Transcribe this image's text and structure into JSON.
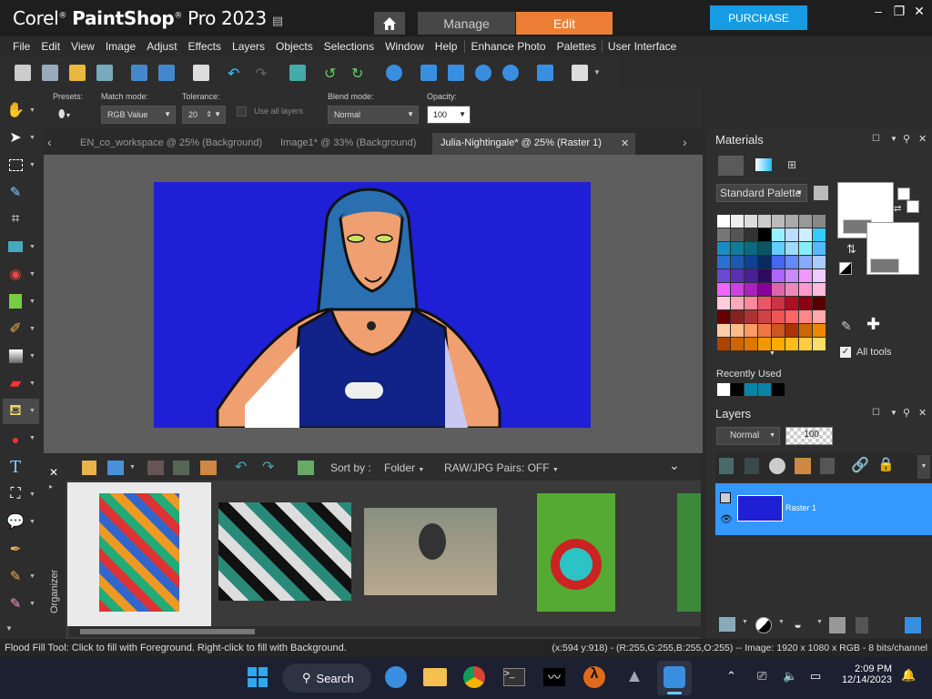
{
  "app": {
    "brand": "Corel",
    "product": "PaintShop",
    "version": "Pro 2023"
  },
  "workspace_tabs": {
    "manage": "Manage",
    "edit": "Edit"
  },
  "purchase": "PURCHASE",
  "menu": [
    "File",
    "Edit",
    "View",
    "Image",
    "Adjust",
    "Effects",
    "Layers",
    "Objects",
    "Selections",
    "Window",
    "Help",
    "Enhance Photo",
    "Palettes",
    "User Interface"
  ],
  "options": {
    "presets_label": "Presets:",
    "match_mode_label": "Match mode:",
    "match_mode_value": "RGB Value",
    "tolerance_label": "Tolerance:",
    "tolerance_value": "20",
    "use_all_layers": "Use all layers",
    "blend_mode_label": "Blend mode:",
    "blend_mode_value": "Normal",
    "opacity_label": "Opacity:",
    "opacity_value": "100"
  },
  "doc_tabs": [
    {
      "label": "EN_co_workspace @  25% (Background)",
      "active": false
    },
    {
      "label": "Image1* @  33% (Background)",
      "active": false
    },
    {
      "label": "Julia-Nightingale* @  25% (Raster 1)",
      "active": true
    }
  ],
  "organizer": {
    "label": "Organizer",
    "sort_by_label": "Sort by :",
    "sort_by_value": "Folder",
    "raw_pairs": "RAW/JPG Pairs: OFF"
  },
  "materials": {
    "title": "Materials",
    "palette_name": "Standard Palette",
    "recently_used": "Recently Used",
    "all_tools": "All tools"
  },
  "layers": {
    "title": "Layers",
    "blend": "Normal",
    "opacity": "100",
    "layer_name": "Raster 1"
  },
  "status": {
    "left": "Flood Fill Tool: Click to fill with Foreground. Right-click to fill with Background.",
    "right": "(x:594 y:918) - (R:255,G:255,B:255,O:255) -- Image:  1920 x 1080 x RGB - 8 bits/channel"
  },
  "taskbar": {
    "search": "Search",
    "time": "2:09 PM",
    "date": "12/14/2023"
  },
  "colors": {
    "accent": "#ee7e35",
    "purchase": "#159ce4",
    "canvas_bg": "#1f1fd6",
    "selected_layer": "#3399ff"
  }
}
